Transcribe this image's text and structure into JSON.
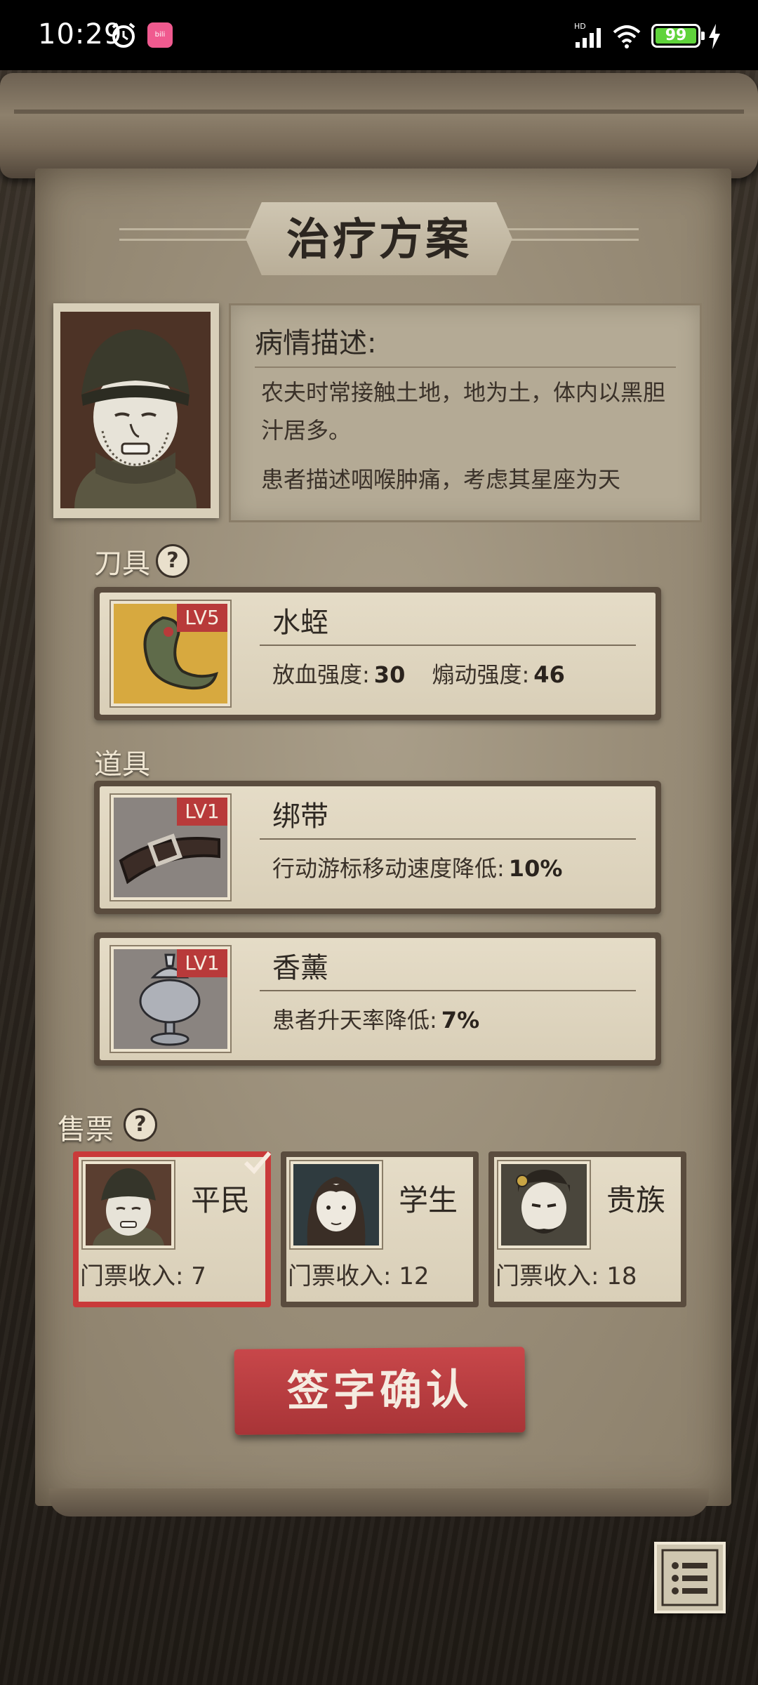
{
  "status_bar": {
    "time": "10:29",
    "battery": "99",
    "battery_level": 0.99,
    "app_icon": "bilibili",
    "accent_battery": "#5fd33b"
  },
  "panel": {
    "title": "治疗方案"
  },
  "condition": {
    "label": "病情描述:",
    "line1": "农夫时常接触土地，地为土，体内以黑胆汁居多。",
    "line2": "患者描述咽喉肿痛，考虑其星座为天"
  },
  "tools": {
    "section_label": "刀具",
    "items": [
      {
        "level": "LV5",
        "name": "水蛭",
        "stat1_label": "放血强度:",
        "stat1_value": "30",
        "stat2_label": "煽动强度:",
        "stat2_value": "46"
      }
    ]
  },
  "props": {
    "section_label": "道具",
    "items": [
      {
        "level": "LV1",
        "name": "绑带",
        "stat_label": "行动游标移动速度降低:",
        "stat_value": "10%"
      },
      {
        "level": "LV1",
        "name": "香薰",
        "stat_label": "患者升天率降低:",
        "stat_value": "7%"
      }
    ]
  },
  "tickets": {
    "section_label": "售票",
    "options": [
      {
        "name": "平民",
        "income": "门票收入: 7",
        "selected": true
      },
      {
        "name": "学生",
        "income": "门票收入: 12",
        "selected": false
      },
      {
        "name": "贵族",
        "income": "门票收入: 18",
        "selected": false
      }
    ]
  },
  "confirm_button": "签字确认",
  "colors": {
    "accent_red": "#c93a3a",
    "paper": "#988c77",
    "card": "#e5dcc7"
  },
  "icons": {
    "help": "help-icon",
    "menu": "list-menu-icon",
    "check": "checkmark-icon"
  }
}
